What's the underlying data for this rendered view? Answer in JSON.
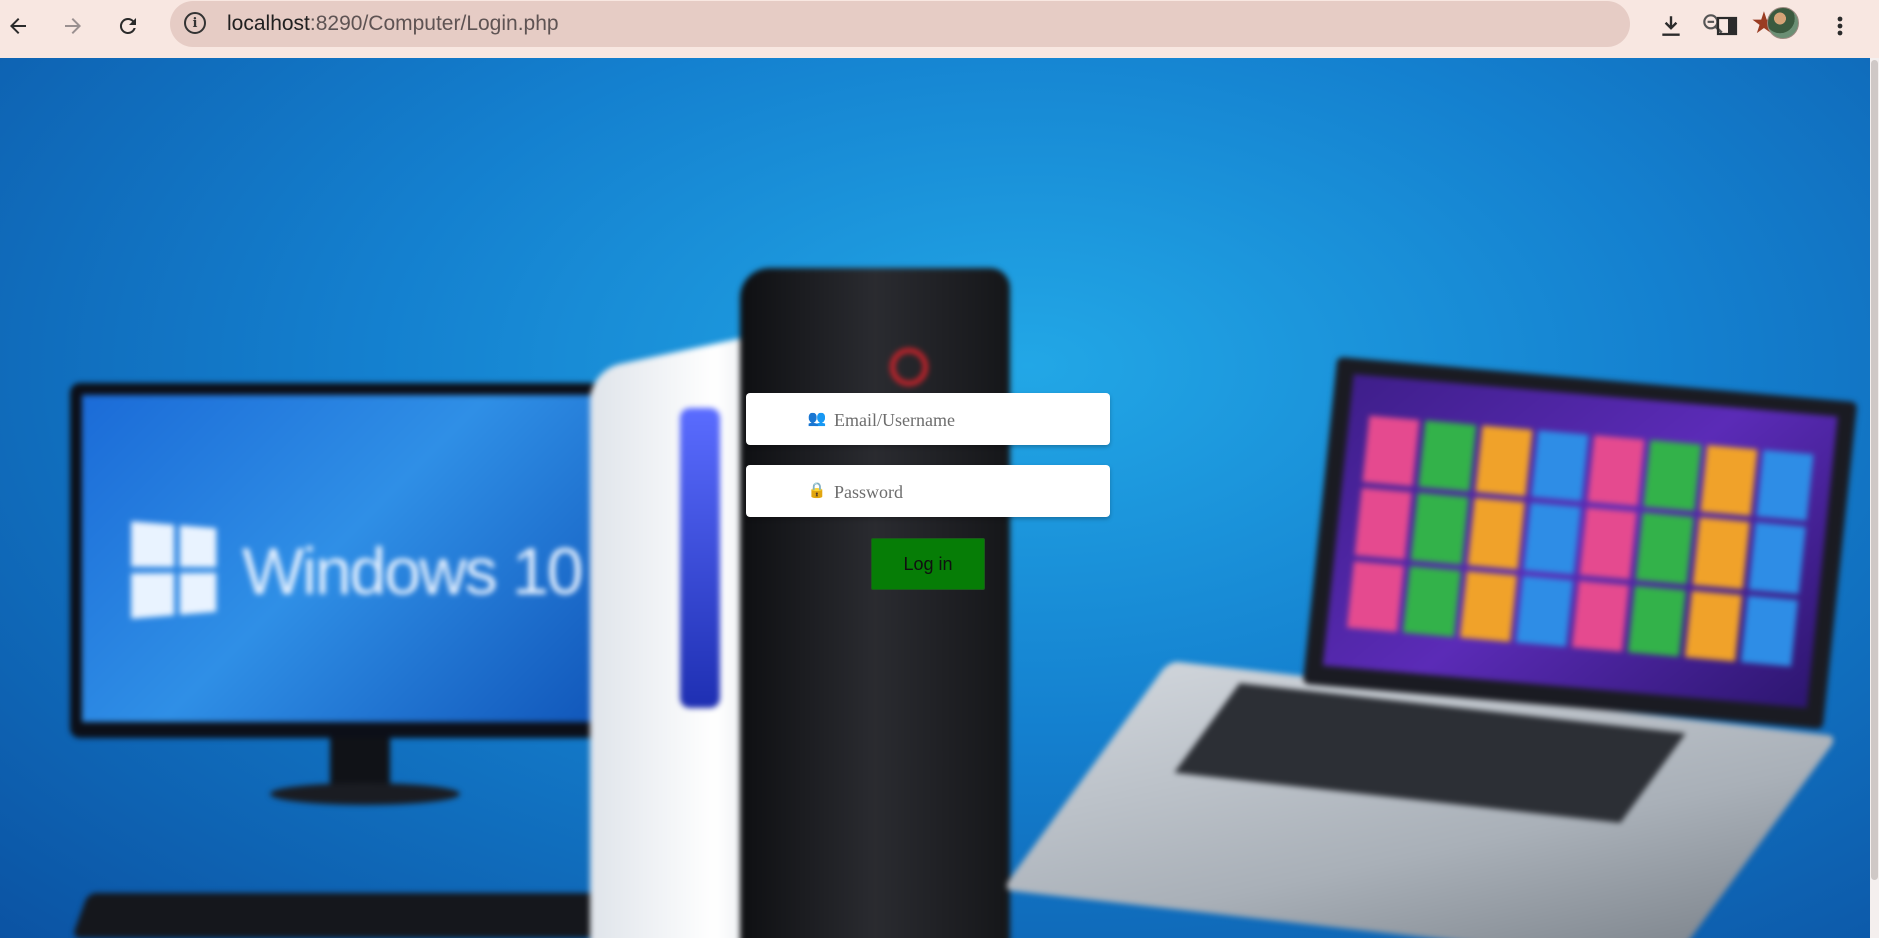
{
  "browser": {
    "url_host": "localhost",
    "url_path": ":8290/Computer/Login.php",
    "info_glyph": "i",
    "icons": [
      "back-icon",
      "forward-icon",
      "reload-icon",
      "site-info-icon",
      "zoom-icon",
      "bookmark-star-icon",
      "download-icon",
      "side-panel-icon",
      "profile-avatar",
      "menu-icon"
    ]
  },
  "background": {
    "monitor_text": "Windows 10"
  },
  "login": {
    "username_placeholder": "Email/Username",
    "password_placeholder": "Password",
    "username_icon": "users-icon",
    "password_icon": "lock-icon",
    "submit_label": "Log in"
  },
  "colors": {
    "login_button": "#067d06",
    "bookmark_star": "#9a3c22",
    "toolbar": "#f8e7e1",
    "omnibox": "#e6ccc5"
  }
}
